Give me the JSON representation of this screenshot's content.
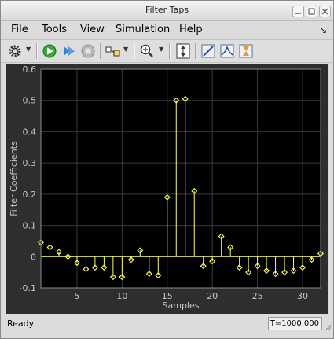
{
  "window": {
    "title": "Filter Taps"
  },
  "menu": {
    "items": [
      {
        "label": "File"
      },
      {
        "label": "Tools"
      },
      {
        "label": "View"
      },
      {
        "label": "Simulation"
      },
      {
        "label": "Help"
      }
    ],
    "overflow_glyph": "↘"
  },
  "toolbar": {
    "icons": [
      "gear-icon",
      "play-icon",
      "step-forward-icon",
      "stop-icon",
      "highlight-block-icon",
      "zoom-in-icon",
      "autoscale-icon",
      "draw-measure-icon",
      "peak-finder-icon",
      "bilevel-measure-icon"
    ]
  },
  "status": {
    "left": "Ready",
    "right": "T=1000.000"
  },
  "chart_data": {
    "type": "stem",
    "xlabel": "Samples",
    "ylabel": "Filter Coefficients",
    "xlim": [
      1,
      32
    ],
    "ylim": [
      -0.1,
      0.6
    ],
    "xticks": [
      5,
      10,
      15,
      20,
      25,
      30
    ],
    "yticks": [
      -0.1,
      0,
      0.1,
      0.2,
      0.3,
      0.4,
      0.5,
      0.6
    ],
    "grid": true,
    "series": [
      {
        "color": "#ffff66",
        "x": [
          1,
          2,
          3,
          4,
          5,
          6,
          7,
          8,
          9,
          10,
          11,
          12,
          13,
          14,
          15,
          16,
          17,
          18,
          19,
          20,
          21,
          22,
          23,
          24,
          25,
          26,
          27,
          28,
          29,
          30,
          31,
          32
        ],
        "values": [
          0.045,
          0.03,
          0.015,
          0.0,
          -0.02,
          -0.04,
          -0.035,
          -0.035,
          -0.065,
          -0.065,
          -0.01,
          0.02,
          -0.055,
          -0.06,
          0.19,
          0.5,
          0.505,
          0.21,
          -0.03,
          -0.015,
          0.065,
          0.03,
          -0.035,
          -0.05,
          -0.03,
          -0.045,
          -0.055,
          -0.05,
          -0.045,
          -0.035,
          -0.01,
          0.01
        ]
      }
    ]
  }
}
